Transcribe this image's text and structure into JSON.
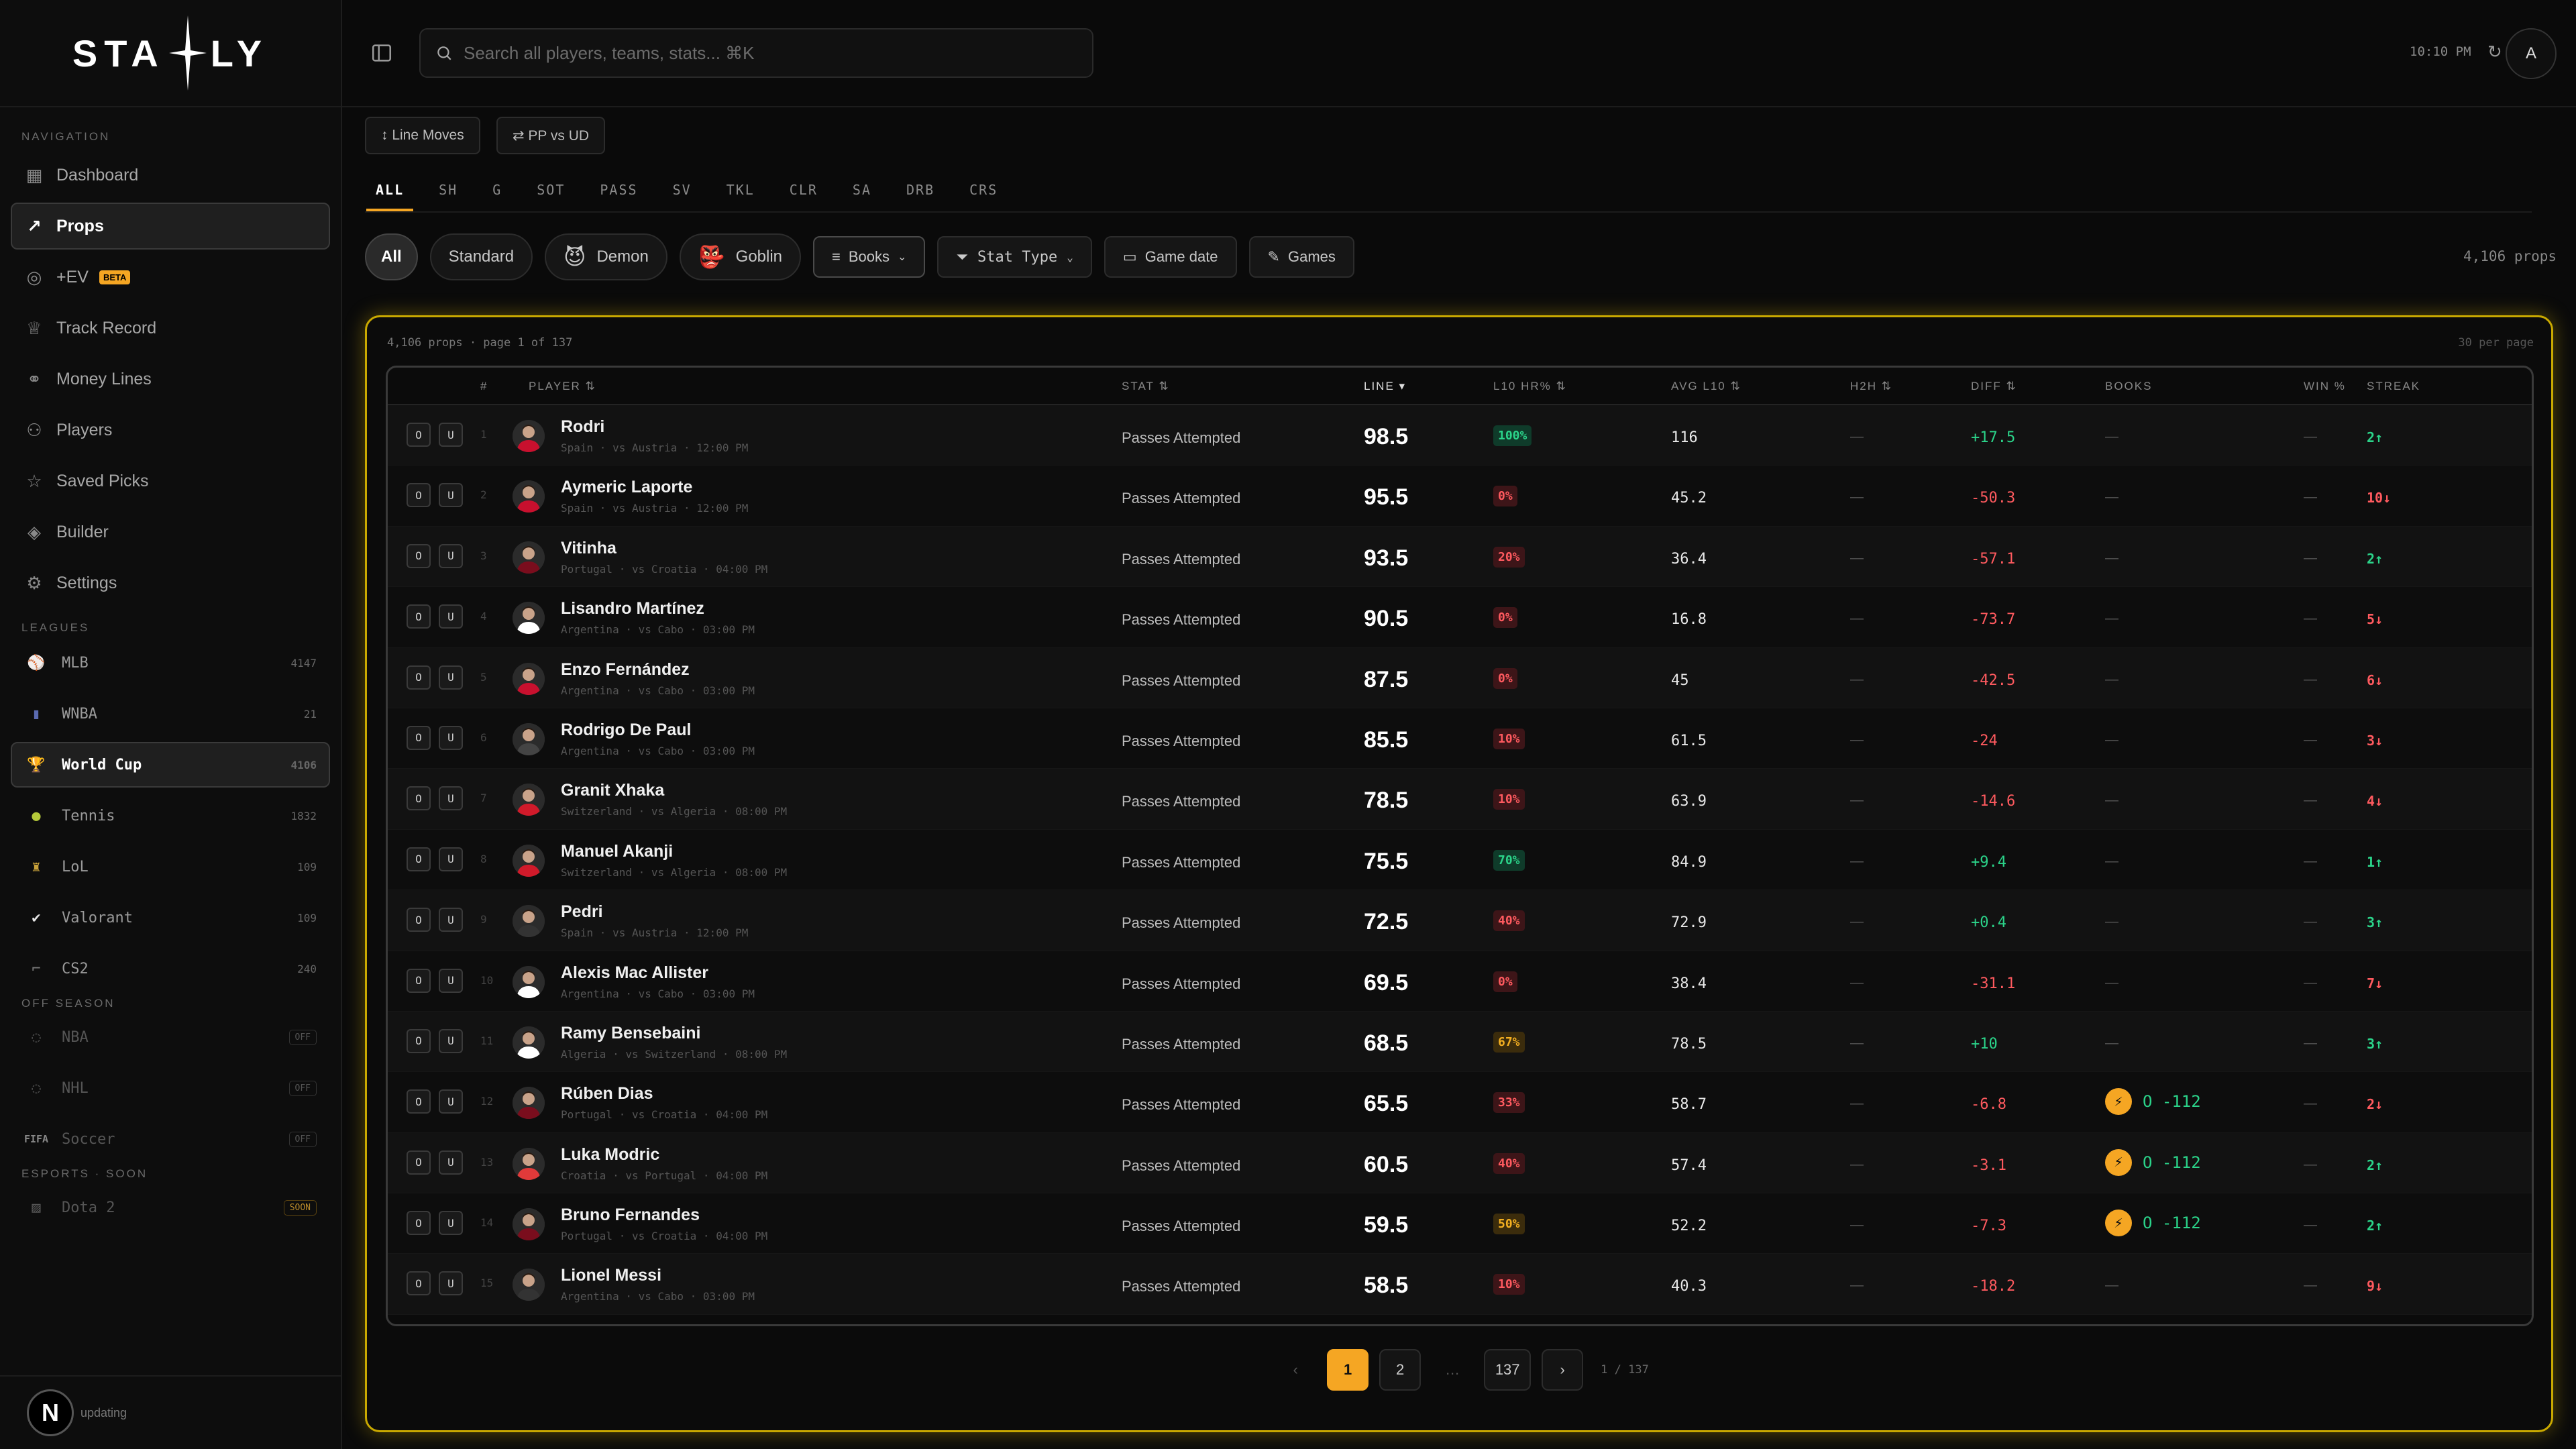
{
  "brand": {
    "left": "STA",
    "right": "LY"
  },
  "sidebar": {
    "nav_label": "NAVIGATION",
    "nav": [
      {
        "label": "Dashboard",
        "icon": "grid-icon",
        "active": false
      },
      {
        "label": "Props",
        "icon": "trend-icon",
        "active": true
      },
      {
        "label": "+EV",
        "icon": "target-icon",
        "active": false,
        "badge": "BETA"
      },
      {
        "label": "Track Record",
        "icon": "trophy-icon",
        "active": false
      },
      {
        "label": "Money Lines",
        "icon": "link-icon",
        "active": false
      },
      {
        "label": "Players",
        "icon": "users-icon",
        "active": false
      },
      {
        "label": "Saved Picks",
        "icon": "star-icon",
        "active": false
      },
      {
        "label": "Builder",
        "icon": "layers-icon",
        "active": false
      },
      {
        "label": "Settings",
        "icon": "gear-icon",
        "active": false
      }
    ],
    "leagues_label": "LEAGUES",
    "leagues": [
      {
        "label": "MLB",
        "count": "4147"
      },
      {
        "label": "WNBA",
        "count": "21"
      },
      {
        "label": "World Cup",
        "count": "4106",
        "active": true
      },
      {
        "label": "Tennis",
        "count": "1832"
      },
      {
        "label": "LoL",
        "count": "109"
      },
      {
        "label": "Valorant",
        "count": "109"
      },
      {
        "label": "CS2",
        "count": "240"
      }
    ],
    "offseason_label": "OFF SEASON",
    "offseason": [
      {
        "label": "NBA",
        "tag": "OFF"
      },
      {
        "label": "NHL",
        "tag": "OFF"
      },
      {
        "label": "Soccer",
        "tag": "OFF",
        "prefix": "FIFA"
      }
    ],
    "esports_label": "ESPORTS · SOON",
    "esports": [
      {
        "label": "Dota 2",
        "tag": "SOON"
      }
    ],
    "footer_badge": "N",
    "footer_status": "updating"
  },
  "topbar": {
    "search_placeholder": "Search all players, teams, stats... ⌘K",
    "time": "10:10 PM",
    "avatar": "A"
  },
  "toolbar": {
    "line_moves": "↕ Line Moves",
    "pp_vs_ud": "⇄ PP vs UD"
  },
  "stat_tabs": [
    "ALL",
    "SH",
    "G",
    "SOT",
    "PASS",
    "SV",
    "TKL",
    "CLR",
    "SA",
    "DRB",
    "CRS"
  ],
  "filters": {
    "all": "All",
    "standard": "Standard",
    "demon": "Demon",
    "goblin": "Goblin",
    "books": "Books",
    "stat_type": "Stat Type",
    "game_date": "Game date",
    "games": "Games",
    "props_count": "4,106 props"
  },
  "table": {
    "summary": "4,106 props · page 1 of 137",
    "per_page": "30 per page",
    "headers": {
      "num": "#",
      "player": "PLAYER ⇅",
      "stat": "STAT ⇅",
      "line": "LINE ▾",
      "hr": "L10 HR% ⇅",
      "avg": "AVG L10 ⇅",
      "h2h": "H2H ⇅",
      "diff": "DIFF ⇅",
      "books": "BOOKS",
      "win": "WIN %",
      "streak": "STREAK"
    },
    "over": "O",
    "under": "U",
    "rows": [
      {
        "n": "1",
        "name": "Rodri",
        "sub": "Spain · vs Austria · 12:00 PM",
        "stat": "Passes Attempted",
        "line": "98.5",
        "hr": "100%",
        "hrc": "g",
        "avg": "116",
        "h2h": "—",
        "diff": "+17.5",
        "book": "—",
        "win": "—",
        "streak": "2↑",
        "sc": "pos",
        "jersey": "#c8102e"
      },
      {
        "n": "2",
        "name": "Aymeric Laporte",
        "sub": "Spain · vs Austria · 12:00 PM",
        "stat": "Passes Attempted",
        "line": "95.5",
        "hr": "0%",
        "hrc": "r",
        "avg": "45.2",
        "h2h": "—",
        "diff": "-50.3",
        "book": "—",
        "win": "—",
        "streak": "10↓",
        "sc": "neg",
        "jersey": "#c8102e"
      },
      {
        "n": "3",
        "name": "Vitinha",
        "sub": "Portugal · vs Croatia · 04:00 PM",
        "stat": "Passes Attempted",
        "line": "93.5",
        "hr": "20%",
        "hrc": "r",
        "avg": "36.4",
        "h2h": "—",
        "diff": "-57.1",
        "book": "—",
        "win": "—",
        "streak": "2↑",
        "sc": "pos",
        "jersey": "#7a0d1d"
      },
      {
        "n": "4",
        "name": "Lisandro Martínez",
        "sub": "Argentina · vs Cabo · 03:00 PM",
        "stat": "Passes Attempted",
        "line": "90.5",
        "hr": "0%",
        "hrc": "r",
        "avg": "16.8",
        "h2h": "—",
        "diff": "-73.7",
        "book": "—",
        "win": "—",
        "streak": "5↓",
        "sc": "neg",
        "jersey": "#ffffff"
      },
      {
        "n": "5",
        "name": "Enzo Fernández",
        "sub": "Argentina · vs Cabo · 03:00 PM",
        "stat": "Passes Attempted",
        "line": "87.5",
        "hr": "0%",
        "hrc": "r",
        "avg": "45",
        "h2h": "—",
        "diff": "-42.5",
        "book": "—",
        "win": "—",
        "streak": "6↓",
        "sc": "neg",
        "jersey": "#c8102e"
      },
      {
        "n": "6",
        "name": "Rodrigo De Paul",
        "sub": "Argentina · vs Cabo · 03:00 PM",
        "stat": "Passes Attempted",
        "line": "85.5",
        "hr": "10%",
        "hrc": "r",
        "avg": "61.5",
        "h2h": "—",
        "diff": "-24",
        "book": "—",
        "win": "—",
        "streak": "3↓",
        "sc": "neg",
        "jersey": "#444444"
      },
      {
        "n": "7",
        "name": "Granit Xhaka",
        "sub": "Switzerland · vs Algeria · 08:00 PM",
        "stat": "Passes Attempted",
        "line": "78.5",
        "hr": "10%",
        "hrc": "r",
        "avg": "63.9",
        "h2h": "—",
        "diff": "-14.6",
        "book": "—",
        "win": "—",
        "streak": "4↓",
        "sc": "neg",
        "jersey": "#d11a2a"
      },
      {
        "n": "8",
        "name": "Manuel Akanji",
        "sub": "Switzerland · vs Algeria · 08:00 PM",
        "stat": "Passes Attempted",
        "line": "75.5",
        "hr": "70%",
        "hrc": "g",
        "avg": "84.9",
        "h2h": "—",
        "diff": "+9.4",
        "book": "—",
        "win": "—",
        "streak": "1↑",
        "sc": "pos",
        "jersey": "#d11a2a"
      },
      {
        "n": "9",
        "name": "Pedri",
        "sub": "Spain · vs Austria · 12:00 PM",
        "stat": "Passes Attempted",
        "line": "72.5",
        "hr": "40%",
        "hrc": "r",
        "avg": "72.9",
        "h2h": "—",
        "diff": "+0.4",
        "book": "—",
        "win": "—",
        "streak": "3↑",
        "sc": "pos",
        "jersey": "#333333"
      },
      {
        "n": "10",
        "name": "Alexis Mac Allister",
        "sub": "Argentina · vs Cabo · 03:00 PM",
        "stat": "Passes Attempted",
        "line": "69.5",
        "hr": "0%",
        "hrc": "r",
        "avg": "38.4",
        "h2h": "—",
        "diff": "-31.1",
        "book": "—",
        "win": "—",
        "streak": "7↓",
        "sc": "neg",
        "jersey": "#ffffff"
      },
      {
        "n": "11",
        "name": "Ramy Bensebaini",
        "sub": "Algeria · vs Switzerland · 08:00 PM",
        "stat": "Passes Attempted",
        "line": "68.5",
        "hr": "67%",
        "hrc": "y",
        "avg": "78.5",
        "h2h": "—",
        "diff": "+10",
        "book": "—",
        "win": "—",
        "streak": "3↑",
        "sc": "pos",
        "jersey": "#ffffff"
      },
      {
        "n": "12",
        "name": "Rúben Dias",
        "sub": "Portugal · vs Croatia · 04:00 PM",
        "stat": "Passes Attempted",
        "line": "65.5",
        "hr": "33%",
        "hrc": "r",
        "avg": "58.7",
        "h2h": "—",
        "diff": "-6.8",
        "book": "O -112",
        "win": "—",
        "streak": "2↓",
        "sc": "neg",
        "jersey": "#7a0d1d"
      },
      {
        "n": "13",
        "name": "Luka Modric",
        "sub": "Croatia · vs Portugal · 04:00 PM",
        "stat": "Passes Attempted",
        "line": "60.5",
        "hr": "40%",
        "hrc": "r",
        "avg": "57.4",
        "h2h": "—",
        "diff": "-3.1",
        "book": "O -112",
        "win": "—",
        "streak": "2↑",
        "sc": "pos",
        "jersey": "#e03a3a"
      },
      {
        "n": "14",
        "name": "Bruno Fernandes",
        "sub": "Portugal · vs Croatia · 04:00 PM",
        "stat": "Passes Attempted",
        "line": "59.5",
        "hr": "50%",
        "hrc": "y",
        "avg": "52.2",
        "h2h": "—",
        "diff": "-7.3",
        "book": "O -112",
        "win": "—",
        "streak": "2↑",
        "sc": "pos",
        "jersey": "#7a0d1d"
      },
      {
        "n": "15",
        "name": "Lionel Messi",
        "sub": "Argentina · vs Cabo · 03:00 PM",
        "stat": "Passes Attempted",
        "line": "58.5",
        "hr": "10%",
        "hrc": "r",
        "avg": "40.3",
        "h2h": "—",
        "diff": "-18.2",
        "book": "—",
        "win": "—",
        "streak": "9↓",
        "sc": "neg",
        "jersey": "#333333"
      }
    ]
  },
  "pager": {
    "prev": "‹",
    "pages": [
      "1",
      "2"
    ],
    "ellipsis": "…",
    "last": "137",
    "next": "›",
    "info": "1 / 137"
  },
  "colors": {
    "accent": "#f5a623",
    "panel_glow": "#c9a900",
    "positive": "#2bd48a",
    "negative": "#ff5a5f"
  }
}
